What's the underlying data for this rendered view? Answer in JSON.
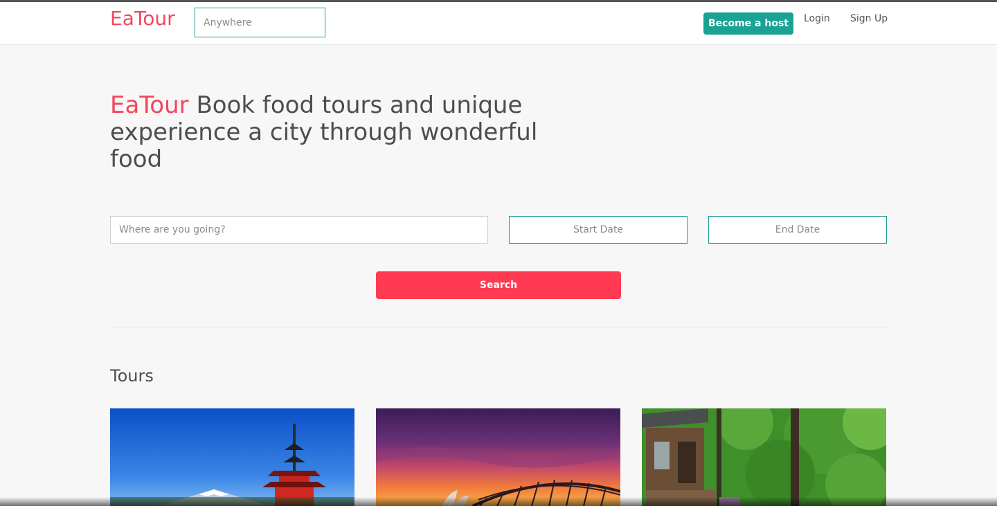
{
  "navbar": {
    "brand": "EaTour",
    "search_placeholder": "Anywhere",
    "host_label": "Become a host",
    "login_label": "Login",
    "signup_label": "Sign Up"
  },
  "hero": {
    "brand": "EaTour",
    "tagline": " Book food tours and unique experience a city through wonderful food"
  },
  "search": {
    "where_placeholder": "Where are you going?",
    "start_placeholder": "Start Date",
    "end_placeholder": "End Date",
    "button_label": "Search"
  },
  "tours": {
    "heading": "Tours",
    "cards": [
      {
        "image": "mount-fuji-pagoda-photo"
      },
      {
        "image": "sydney-harbour-sunset-photo"
      },
      {
        "image": "forest-cabin-photo"
      }
    ]
  },
  "colors": {
    "brand": "#f2465c",
    "teal": "#1aa394",
    "search_button": "#ff3a52",
    "background": "#f7f7f7"
  }
}
